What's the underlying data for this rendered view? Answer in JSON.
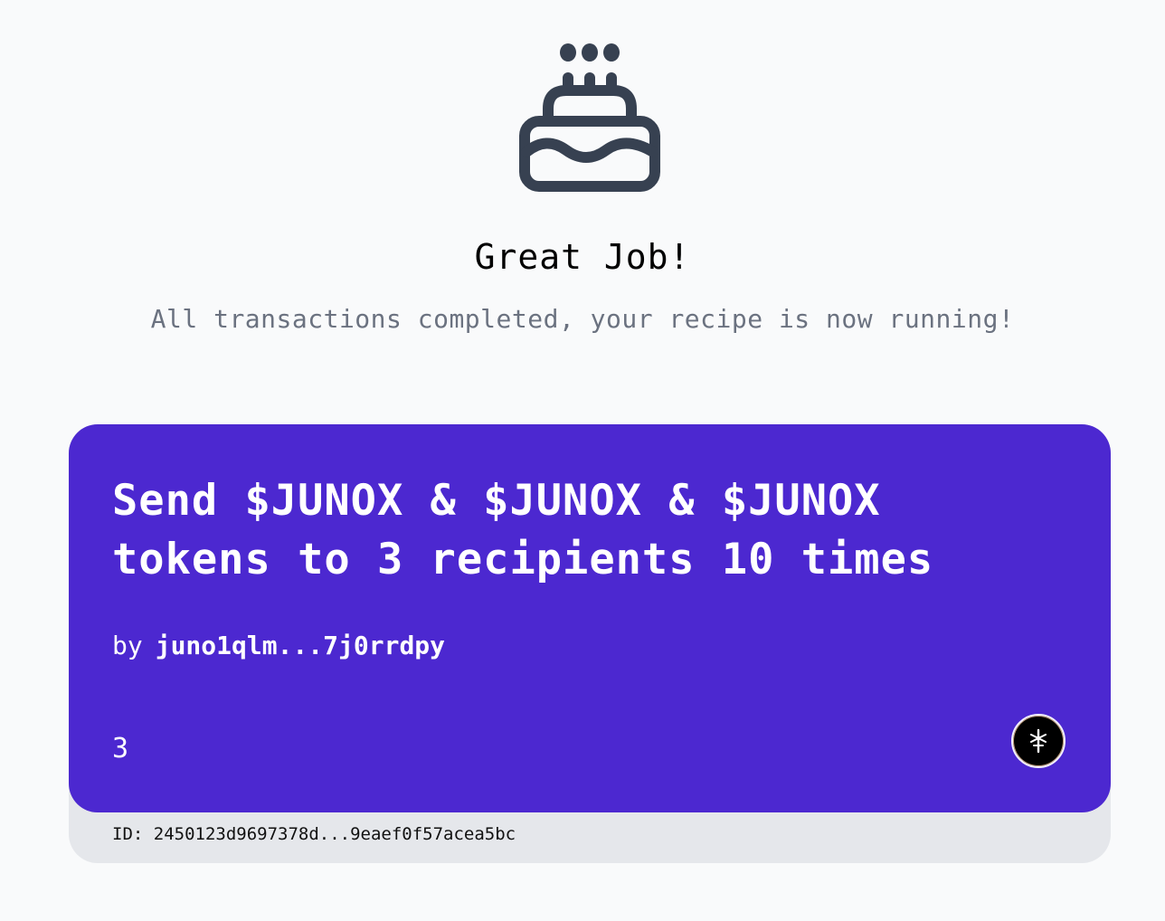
{
  "success": {
    "icon": "cake-icon",
    "headline": "Great Job!",
    "message": "All transactions completed, your recipe is now running!"
  },
  "recipe_card": {
    "title": "Send $JUNOX & $JUNOX & $JUNOX tokens to 3 recipients 10 times",
    "author_prefix": "by",
    "author": "juno1qlm...7j0rrdpy",
    "count": "3",
    "chain_icon": "juno-chain-icon",
    "id_text": "ID: 2450123d9697378d...9eaef0f57acea5bc"
  },
  "colors": {
    "background": "#f9fafb",
    "card": "#4c28d0",
    "card_footer": "#e5e7eb",
    "icon": "#374151",
    "muted_text": "#6b7280"
  }
}
